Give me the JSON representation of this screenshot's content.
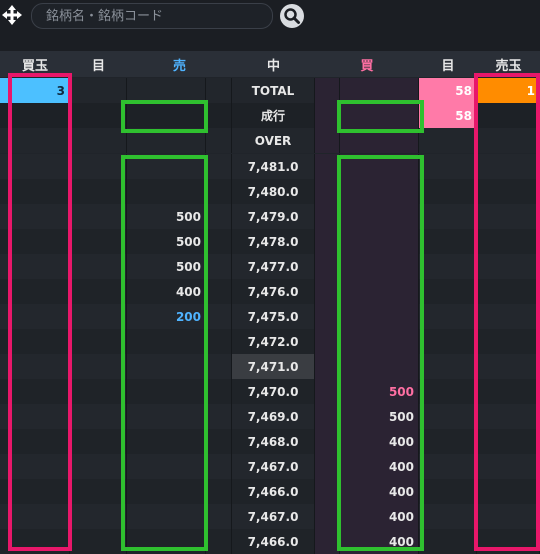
{
  "search": {
    "placeholder": "銘柄名・銘柄コード"
  },
  "headers": {
    "kaidama": "買玉",
    "me_left": "目",
    "uri": "売",
    "naka": "中",
    "kai": "買",
    "me_right": "目",
    "uridama": "売玉"
  },
  "summary_rows": [
    {
      "kaidama": "3",
      "uri": "",
      "price": "TOTAL",
      "kai": "",
      "me_right": "58",
      "uridama": "1"
    },
    {
      "kaidama": "",
      "uri": "",
      "price": "成行",
      "kai": "",
      "me_right": "58",
      "uridama": ""
    },
    {
      "kaidama": "",
      "uri": "",
      "price": "OVER",
      "kai": "",
      "me_right": "",
      "uridama": ""
    }
  ],
  "price_rows": [
    {
      "price": "7,481.0",
      "uri": "",
      "kai": ""
    },
    {
      "price": "7,480.0",
      "uri": "",
      "kai": ""
    },
    {
      "price": "7,479.0",
      "uri": "500",
      "kai": ""
    },
    {
      "price": "7,478.0",
      "uri": "500",
      "kai": ""
    },
    {
      "price": "7,477.0",
      "uri": "500",
      "kai": ""
    },
    {
      "price": "7,476.0",
      "uri": "400",
      "kai": ""
    },
    {
      "price": "7,475.0",
      "uri": "200",
      "kai": ""
    },
    {
      "price": "7,472.0",
      "uri": "",
      "kai": ""
    },
    {
      "price": "7,471.0",
      "uri": "",
      "kai": ""
    },
    {
      "price": "7,470.0",
      "uri": "",
      "kai": "500"
    },
    {
      "price": "7,469.0",
      "uri": "",
      "kai": "500"
    },
    {
      "price": "7,468.0",
      "uri": "",
      "kai": "400"
    },
    {
      "price": "7,467.0",
      "uri": "",
      "kai": "400"
    },
    {
      "price": "7,466.0",
      "uri": "",
      "kai": "400"
    },
    {
      "price": "7,467.0",
      "uri": "",
      "kai": "400"
    },
    {
      "price": "7,466.0",
      "uri": "",
      "kai": "400"
    }
  ],
  "colors": {
    "sell_accent": "#4fb3ff",
    "buy_accent": "#ff6fa3",
    "kaidama_fill": "#4cc0ff",
    "uridama_fill": "#ff8c00",
    "highlight_red": "#e8176a",
    "highlight_green": "#2fc02f"
  },
  "icons": {
    "move": "move-arrows-icon",
    "search": "magnifier-icon"
  }
}
